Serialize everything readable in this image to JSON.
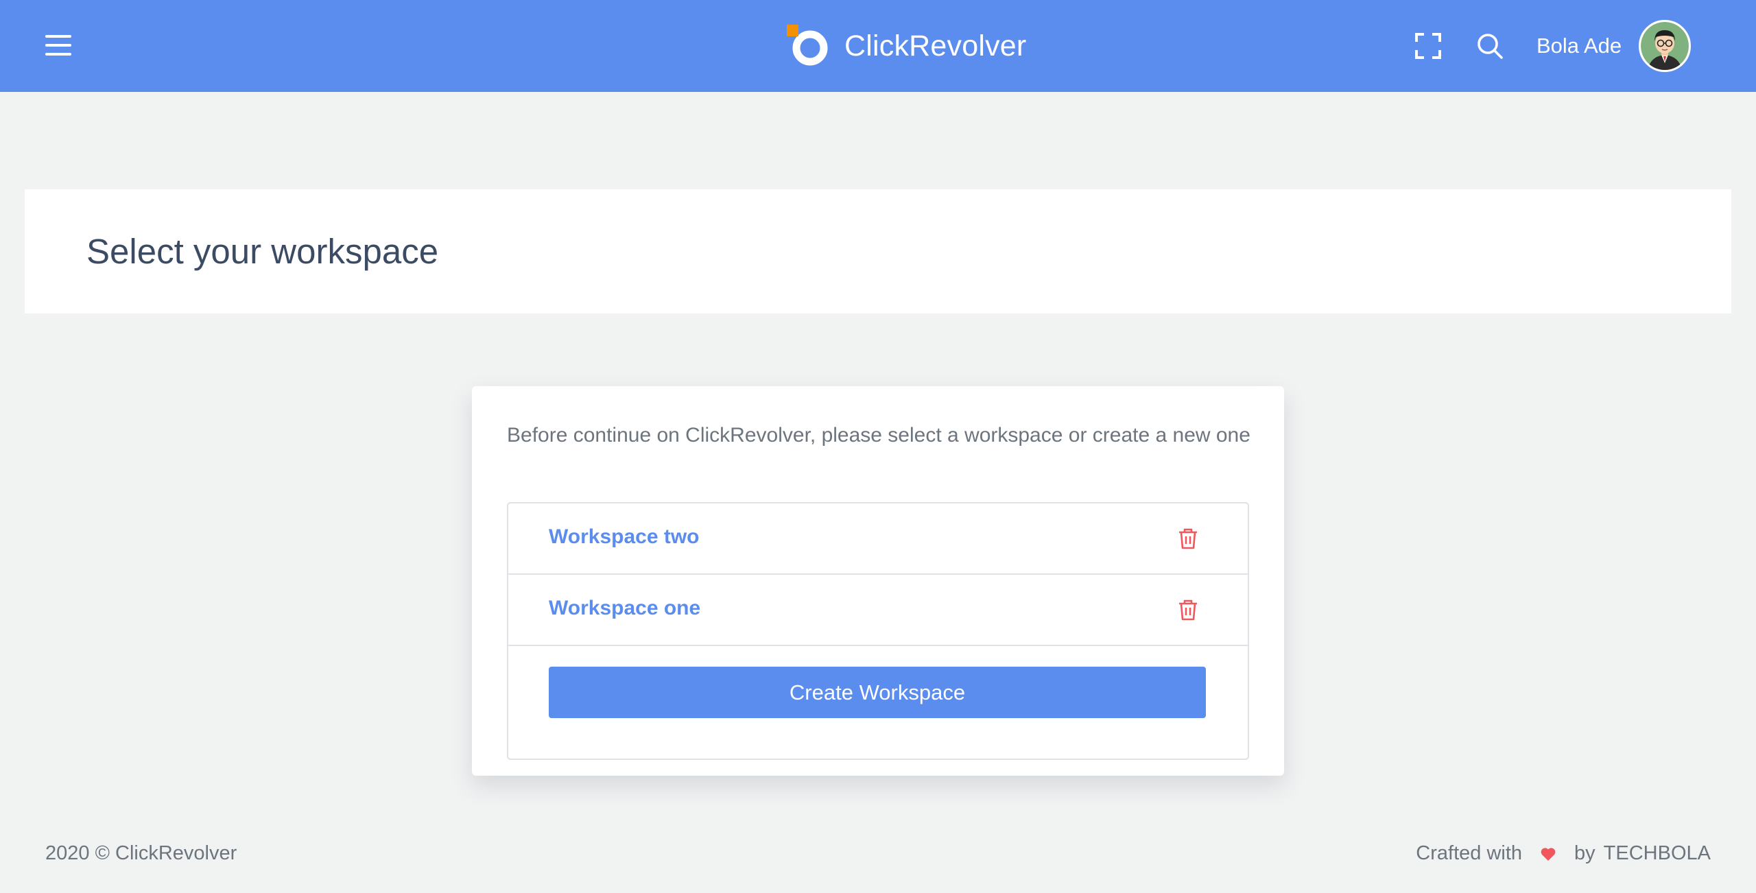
{
  "topbar": {
    "brand_name": "ClickRevolver",
    "user_name": "Bola Ade",
    "icons": {
      "menu": "hamburger-menu-icon",
      "fullscreen": "fullscreen-icon",
      "search": "search-icon"
    }
  },
  "page": {
    "title": "Select your workspace"
  },
  "card": {
    "intro": "Before continue on ClickRevolver, please select a workspace or create a new one",
    "workspaces": [
      {
        "name": "Workspace two"
      },
      {
        "name": "Workspace one"
      }
    ],
    "create_label": "Create Workspace"
  },
  "footer": {
    "copyright": "2020 © ClickRevolver",
    "crafted_with": "Crafted with",
    "by": "by",
    "author": "TECHBOLA"
  },
  "colors": {
    "primary": "#5b8def",
    "danger": "#f0565b",
    "logo_accent": "#f39200",
    "background": "#f1f3f3"
  }
}
